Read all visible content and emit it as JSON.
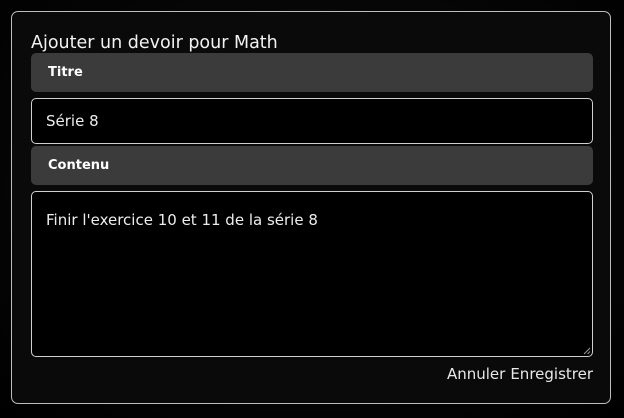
{
  "dialog": {
    "title": "Ajouter un devoir pour Math"
  },
  "title_section": {
    "header": "Titre",
    "value": "Série 8"
  },
  "content_section": {
    "header": "Contenu",
    "value": "Finir l'exercice 10 et 11 de la série 8"
  },
  "actions": {
    "cancel_label": "Annuler",
    "save_label": "Enregistrer"
  },
  "icons": {
    "resize_grip": "resize-grip-icon"
  },
  "colors": {
    "background": "#000000",
    "dialog_border": "#bdbdbd",
    "section_header_bg": "#3b3b3b",
    "input_border": "#d0d0d0",
    "text": "#ededed"
  }
}
